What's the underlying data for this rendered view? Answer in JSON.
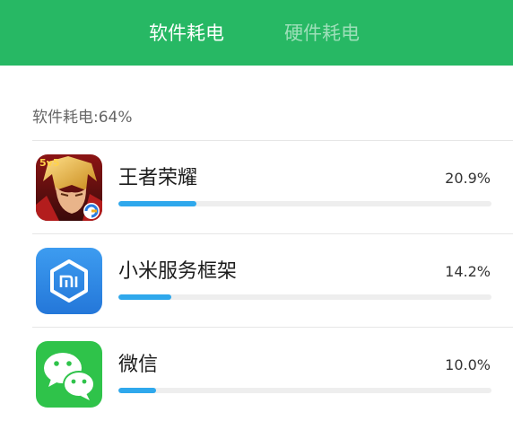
{
  "tabs": [
    {
      "label": "软件耗电",
      "active": true
    },
    {
      "label": "硬件耗电",
      "active": false
    }
  ],
  "summary": {
    "label": "软件耗电:64%"
  },
  "apps": [
    {
      "name": "王者荣耀",
      "percent": "20.9%",
      "usage_fraction": 0.209,
      "icon": "honor-of-kings-icon"
    },
    {
      "name": "小米服务框架",
      "percent": "14.2%",
      "usage_fraction": 0.142,
      "icon": "mi-hexagon-icon"
    },
    {
      "name": "微信",
      "percent": "10.0%",
      "usage_fraction": 0.1,
      "icon": "wechat-icon"
    }
  ],
  "colors": {
    "header_bg": "#27b864",
    "bar_fill": "#2fa8ec",
    "bar_track": "#eeeeee",
    "mi_icon_bg": "#2f8fe6",
    "wechat_icon_bg": "#2fc34a"
  }
}
